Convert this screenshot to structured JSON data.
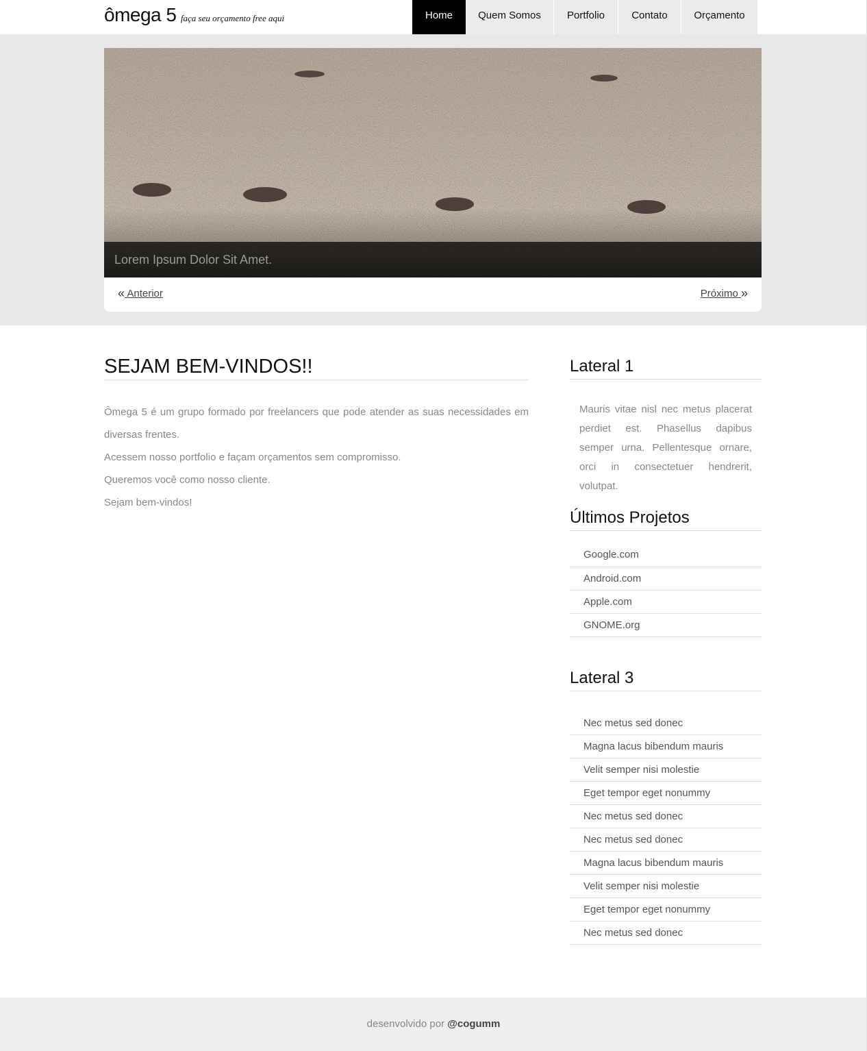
{
  "header": {
    "title": "ômega 5",
    "tagline": "faça seu orçamento free aqui",
    "nav": [
      {
        "label": "Home",
        "active": true
      },
      {
        "label": "Quem Somos",
        "active": false
      },
      {
        "label": "Portfolio",
        "active": false
      },
      {
        "label": "Contato",
        "active": false
      },
      {
        "label": "Orçamento",
        "active": false
      }
    ]
  },
  "slider": {
    "caption": "Lorem Ipsum Dolor Sit Amet.",
    "prev_label": "Anterior",
    "next_label": "Próximo"
  },
  "main": {
    "heading": "SEJAM BEM-VINDOS!!",
    "paragraphs": [
      "Ômega 5 é um grupo formado por freelancers que pode atender as suas necessidades em diversas frentes.",
      "Acessem nosso portfolio e façam orçamentos sem compromisso.",
      "Queremos você como nosso cliente.",
      "Sejam bem-vindos!"
    ]
  },
  "sidebar": {
    "widget1": {
      "title": "Lateral 1",
      "text": "Mauris vitae nisl nec metus placerat perdiet est. Phasellus dapibus semper urna. Pellentesque ornare, orci in consectetuer hendrerit, volutpat."
    },
    "widget2": {
      "title": "Últimos Projetos",
      "items": [
        "Google.com",
        "Android.com",
        "Apple.com",
        "GNOME.org"
      ]
    },
    "widget3": {
      "title": "Lateral 3",
      "items": [
        "Nec metus sed donec",
        "Magna lacus bibendum mauris",
        "Velit semper nisi molestie",
        "Eget tempor eget nonummy",
        "Nec metus sed donec",
        "Nec metus sed donec",
        "Magna lacus bibendum mauris",
        "Velit semper nisi molestie",
        "Eget tempor eget nonummy",
        "Nec metus sed donec"
      ]
    }
  },
  "footer": {
    "prefix": "desenvolvido por",
    "author": "@cogumm"
  },
  "colors": {
    "nav_active_bg": "#000000",
    "nav_bg": "#ebebeb",
    "hero_band_bg": "#e8e8e8",
    "footer_bg": "#efefef"
  }
}
